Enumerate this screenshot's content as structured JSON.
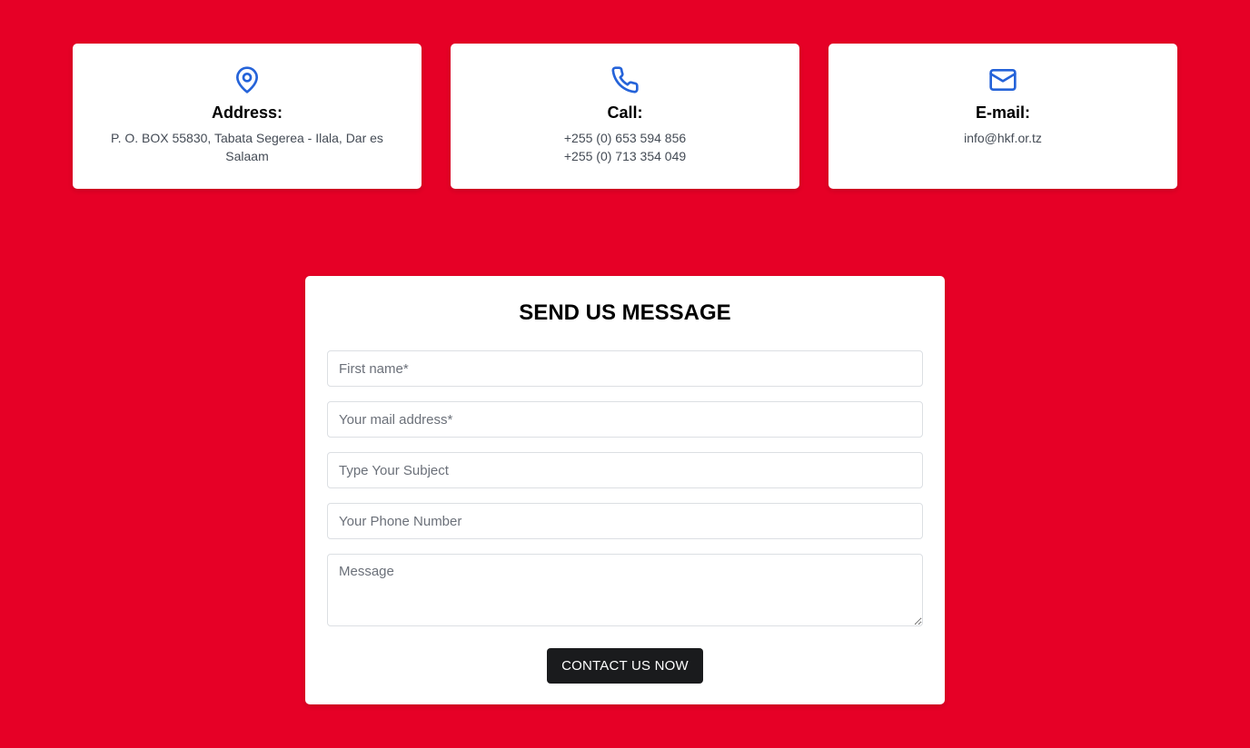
{
  "colors": {
    "background": "#e60026",
    "card": "#ffffff",
    "icon": "#2563d9",
    "button": "#1a1b1d"
  },
  "info_cards": [
    {
      "icon": "map-pin-icon",
      "title": "Address:",
      "lines": [
        "P. O. BOX 55830, Tabata Segerea - Ilala, Dar es Salaam"
      ]
    },
    {
      "icon": "phone-icon",
      "title": "Call:",
      "lines": [
        "+255 (0) 653 594 856",
        "+255 (0) 713 354 049"
      ]
    },
    {
      "icon": "mail-icon",
      "title": "E-mail:",
      "lines": [
        "info@hkf.or.tz"
      ]
    }
  ],
  "form": {
    "title": "SEND US MESSAGE",
    "fields": {
      "first_name": {
        "placeholder": "First name*",
        "value": ""
      },
      "email": {
        "placeholder": "Your mail address*",
        "value": ""
      },
      "subject": {
        "placeholder": "Type Your Subject",
        "value": ""
      },
      "phone": {
        "placeholder": "Your Phone Number",
        "value": ""
      },
      "message": {
        "placeholder": "Message",
        "value": ""
      }
    },
    "submit_label": "CONTACT US NOW"
  }
}
